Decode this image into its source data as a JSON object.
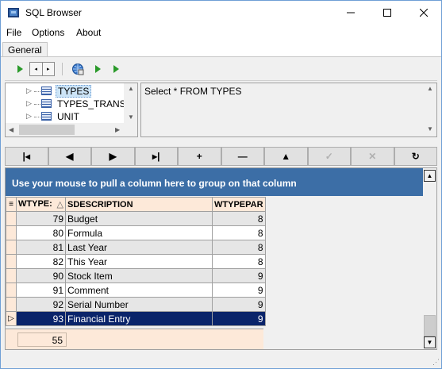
{
  "window": {
    "title": "SQL Browser",
    "min_label": "—",
    "max_label": "☐",
    "close_label": "✕"
  },
  "menu": {
    "items": [
      "File",
      "Options",
      "About"
    ]
  },
  "tabs": [
    {
      "label": "General"
    }
  ],
  "toolbar": {
    "nav_left": "◂",
    "nav_right": "▸"
  },
  "tree": {
    "items": [
      {
        "label": "TYPES",
        "selected": true
      },
      {
        "label": "TYPES_TRANSL",
        "selected": false
      },
      {
        "label": "UNIT",
        "selected": false
      }
    ]
  },
  "sql": {
    "text": "Select * FROM TYPES"
  },
  "navigator": {
    "buttons": [
      {
        "name": "first-record-button",
        "label": "|◂",
        "disabled": false
      },
      {
        "name": "prior-record-button",
        "label": "◀",
        "disabled": false
      },
      {
        "name": "next-record-button",
        "label": "▶",
        "disabled": false
      },
      {
        "name": "last-record-button",
        "label": "▸|",
        "disabled": false
      },
      {
        "name": "insert-record-button",
        "label": "+",
        "disabled": false
      },
      {
        "name": "delete-record-button",
        "label": "—",
        "disabled": false
      },
      {
        "name": "edit-record-button",
        "label": "▲",
        "disabled": false
      },
      {
        "name": "post-edit-button",
        "label": "✓",
        "disabled": true
      },
      {
        "name": "cancel-edit-button",
        "label": "✕",
        "disabled": true
      },
      {
        "name": "refresh-data-button",
        "label": "↻",
        "disabled": false
      }
    ]
  },
  "grid": {
    "group_hint": "Use your mouse to pull a column here to group on that column",
    "columns": [
      "WTYPE:",
      "SDESCRIPTION",
      "WTYPEPAR"
    ],
    "sort_glyph": "△",
    "rows": [
      {
        "id": "79",
        "desc": "Budget",
        "par": "8"
      },
      {
        "id": "80",
        "desc": "Formula",
        "par": "8"
      },
      {
        "id": "81",
        "desc": "Last Year",
        "par": "8"
      },
      {
        "id": "82",
        "desc": "This Year",
        "par": "8"
      },
      {
        "id": "90",
        "desc": "Stock Item",
        "par": "9"
      },
      {
        "id": "91",
        "desc": "Comment",
        "par": "9"
      },
      {
        "id": "92",
        "desc": "Serial Number",
        "par": "9"
      },
      {
        "id": "93",
        "desc": "Financial Entry",
        "par": "9"
      }
    ],
    "selected_index": 7,
    "footer_count": "55"
  },
  "colors": {
    "group_bar": "#3c6ea6",
    "selection": "#0a246a",
    "header_bg": "#fde9d9",
    "play_green": "#2a9a2a"
  }
}
